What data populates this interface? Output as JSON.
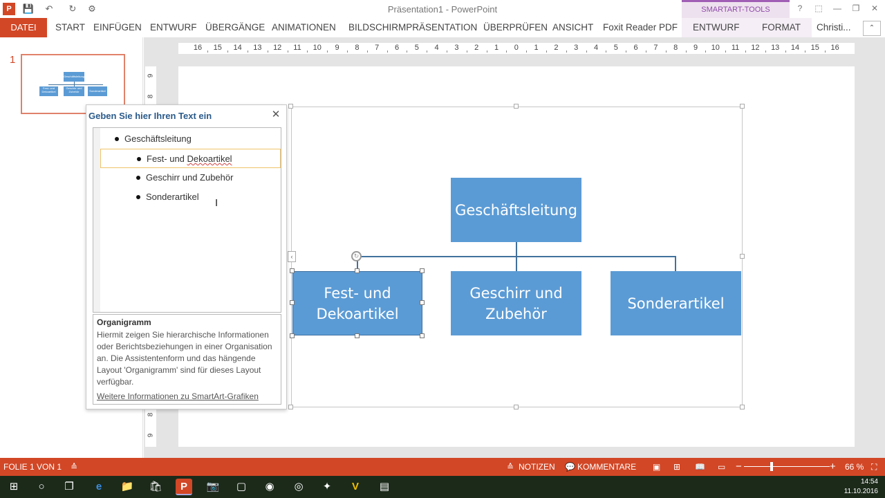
{
  "window": {
    "title": "Präsentation1 - PowerPoint",
    "context_group": "SMARTART-TOOLS",
    "user": "Christi...",
    "help_icon": "?",
    "restore_icon": "⬚",
    "minimize_icon": "—",
    "maximize_icon": "❐",
    "close_icon": "✕"
  },
  "qat": {
    "app_icon": "P",
    "save_icon": "💾",
    "undo_icon": "↶",
    "redo_icon": "↻",
    "custom_icon": "⚙"
  },
  "ribbon": {
    "file_tab": "DATEI",
    "tabs": [
      "START",
      "EINFÜGEN",
      "ENTWURF",
      "ÜBERGÄNGE",
      "ANIMATIONEN",
      "BILDSCHIRMPRÄSENTATION",
      "ÜBERPRÜFEN",
      "ANSICHT",
      "Foxit Reader PDF"
    ],
    "context_tabs": [
      "ENTWURF",
      "FORMAT"
    ],
    "collapse_icon": "⌃"
  },
  "ruler": {
    "horizontal": [
      "16",
      "15",
      "14",
      "13",
      "12",
      "11",
      "10",
      "9",
      "8",
      "7",
      "6",
      "5",
      "4",
      "3",
      "2",
      "1",
      "0",
      "1",
      "2",
      "3",
      "4",
      "5",
      "6",
      "7",
      "8",
      "9",
      "10",
      "11",
      "12",
      "13",
      "14",
      "15",
      "16"
    ],
    "vertical_top": [
      "9",
      "8"
    ],
    "vertical_bottom": [
      "8",
      "9"
    ]
  },
  "thumbnail": {
    "number": "1",
    "root": "Geschäftsleitung",
    "children": [
      "Fest- und Dekoartikel",
      "Geschirr und Zubehör",
      "Sonderartikel"
    ]
  },
  "text_pane": {
    "title": "Geben Sie hier Ihren Text ein",
    "close_icon": "✕",
    "items": [
      {
        "text": "Geschäftsleitung",
        "level": 1
      },
      {
        "text_plain": "Fest- und ",
        "text_misspelled": "Dekoartikel",
        "level": 2
      },
      {
        "text": "Geschirr und Zubehör",
        "level": 2
      },
      {
        "text": "Sonderartikel",
        "level": 2
      }
    ],
    "ibeam_icon": "I",
    "description_title": "Organigramm",
    "description": "Hiermit zeigen Sie hierarchische Informationen oder Berichtsbeziehungen in einer Organisation an. Die Assistentenform und das hängende Layout 'Organigramm' sind für dieses Layout verfügbar.",
    "link": "Weitere Informationen zu SmartArt-Grafiken"
  },
  "smartart": {
    "root": "Geschäftsleitung",
    "child1": "Fest- und\nDekoartikel",
    "child2": "Geschirr und\nZubehör",
    "child3": "Sonderartikel",
    "pane_toggle_icon": "‹",
    "rotate_icon": "↻",
    "color": "#5b9bd5"
  },
  "status": {
    "slide_info": "FOLIE 1 VON 1",
    "notes_icon": "≙",
    "notes": "NOTIZEN",
    "comments_icon": "💬",
    "comments": "KOMMENTARE",
    "view_normal_icon": "▣",
    "view_sorter_icon": "⊞",
    "view_reading_icon": "📖",
    "view_show_icon": "▭",
    "zoom_minus": "−",
    "zoom_plus": "+",
    "zoom": "66 %",
    "fit_icon": "⛶",
    "accent": "#d24726"
  },
  "taskbar": {
    "time": "14:54",
    "date": "11.10.2016",
    "icons": [
      "⊞",
      "○",
      "❐",
      "e",
      "📁",
      "🛍",
      "P",
      "📷",
      "▢",
      "◉",
      "◎",
      "✦",
      "V",
      "▤"
    ]
  }
}
